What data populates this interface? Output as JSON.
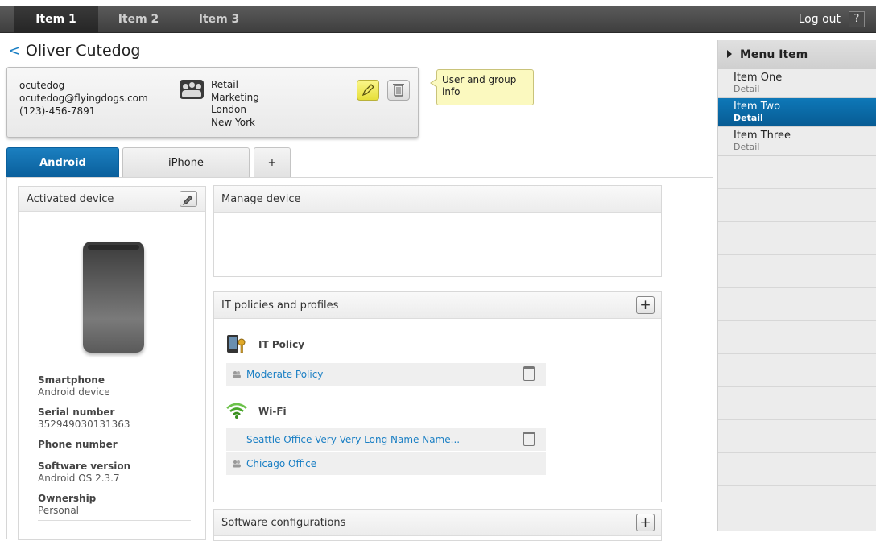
{
  "nav": {
    "tabs": [
      {
        "label": "Item 1"
      },
      {
        "label": "Item 2"
      },
      {
        "label": "Item 3"
      }
    ],
    "logout": "Log out",
    "help": "?"
  },
  "header": {
    "back": "<",
    "title": "Oliver Cutedog"
  },
  "user": {
    "username": "ocutedog",
    "email": "ocutedog@flyingdogs.com",
    "phone": "(123)-456-7891",
    "groups": [
      "Retail",
      "Marketing",
      "London",
      "New York"
    ],
    "tooltip": "User and group info"
  },
  "device_tabs": [
    {
      "label": "Android"
    },
    {
      "label": "iPhone"
    },
    {
      "label": "+"
    }
  ],
  "activated_device": {
    "title": "Activated device",
    "fields": [
      {
        "label": "Smartphone",
        "value": "Android device"
      },
      {
        "label": "Serial number",
        "value": "352949030131363"
      },
      {
        "label": "Phone number",
        "value": ""
      },
      {
        "label": "Software version",
        "value": "Android OS 2.3.7"
      },
      {
        "label": "Ownership",
        "value": "Personal"
      }
    ]
  },
  "manage_device": {
    "title": "Manage device"
  },
  "it_policies": {
    "title": "IT policies and profiles",
    "plus": "+",
    "it_policy": {
      "title": "IT Policy",
      "rows": [
        {
          "label": "Moderate Policy"
        }
      ]
    },
    "wifi": {
      "title": "Wi-Fi",
      "rows": [
        {
          "label": "Seattle Office Very Very Long Name Name..."
        },
        {
          "label": "Chicago Office"
        }
      ]
    }
  },
  "software_configurations": {
    "title": "Software configurations",
    "plus": "+"
  },
  "sidebar": {
    "header": "Menu Item",
    "items": [
      {
        "title": "Item One",
        "detail": "Detail"
      },
      {
        "title": "Item Two",
        "detail": "Detail"
      },
      {
        "title": "Item Three",
        "detail": "Detail"
      }
    ]
  },
  "colors": {
    "accent": "#0a6aaa",
    "link": "#1a7fc4",
    "tooltip_bg": "#fbf9bf"
  }
}
